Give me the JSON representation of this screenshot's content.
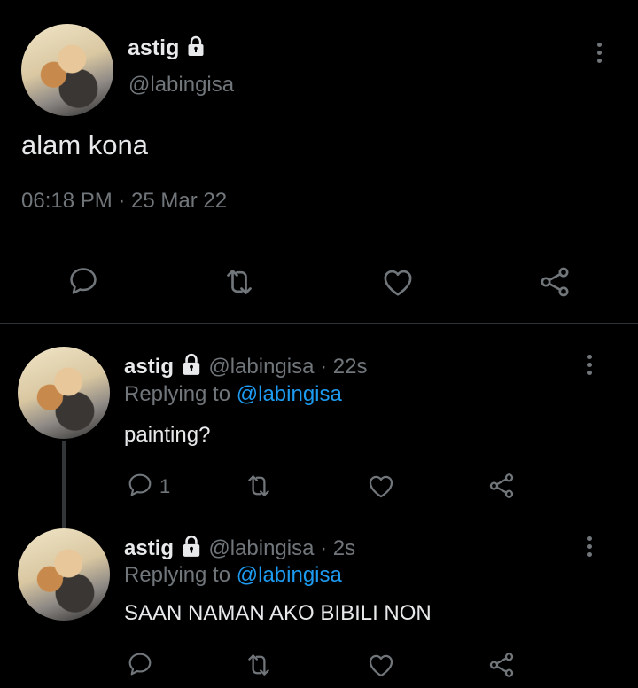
{
  "main_tweet": {
    "display_name": "astig",
    "handle": "@labingisa",
    "text": "alam kona",
    "timestamp": "06:18 PM · 25 Mar 22"
  },
  "replies": [
    {
      "display_name": "astig",
      "handle": "@labingisa",
      "time": "· 22s",
      "replying_prefix": "Replying to",
      "replying_handle": "@labingisa",
      "text": "painting?",
      "reply_count": "1"
    },
    {
      "display_name": "astig",
      "handle": "@labingisa",
      "time": "· 2s",
      "replying_prefix": "Replying to",
      "replying_handle": "@labingisa",
      "text": "SAAN NAMAN AKO BIBILI NON",
      "reply_count": ""
    }
  ],
  "colors": {
    "background": "#000000",
    "text": "#e7e9ea",
    "muted": "#71767b",
    "link": "#1d9bf0",
    "divider": "#2f3336"
  },
  "icons": [
    "lock-icon",
    "more-icon",
    "reply-icon",
    "retweet-icon",
    "like-icon",
    "share-icon"
  ]
}
